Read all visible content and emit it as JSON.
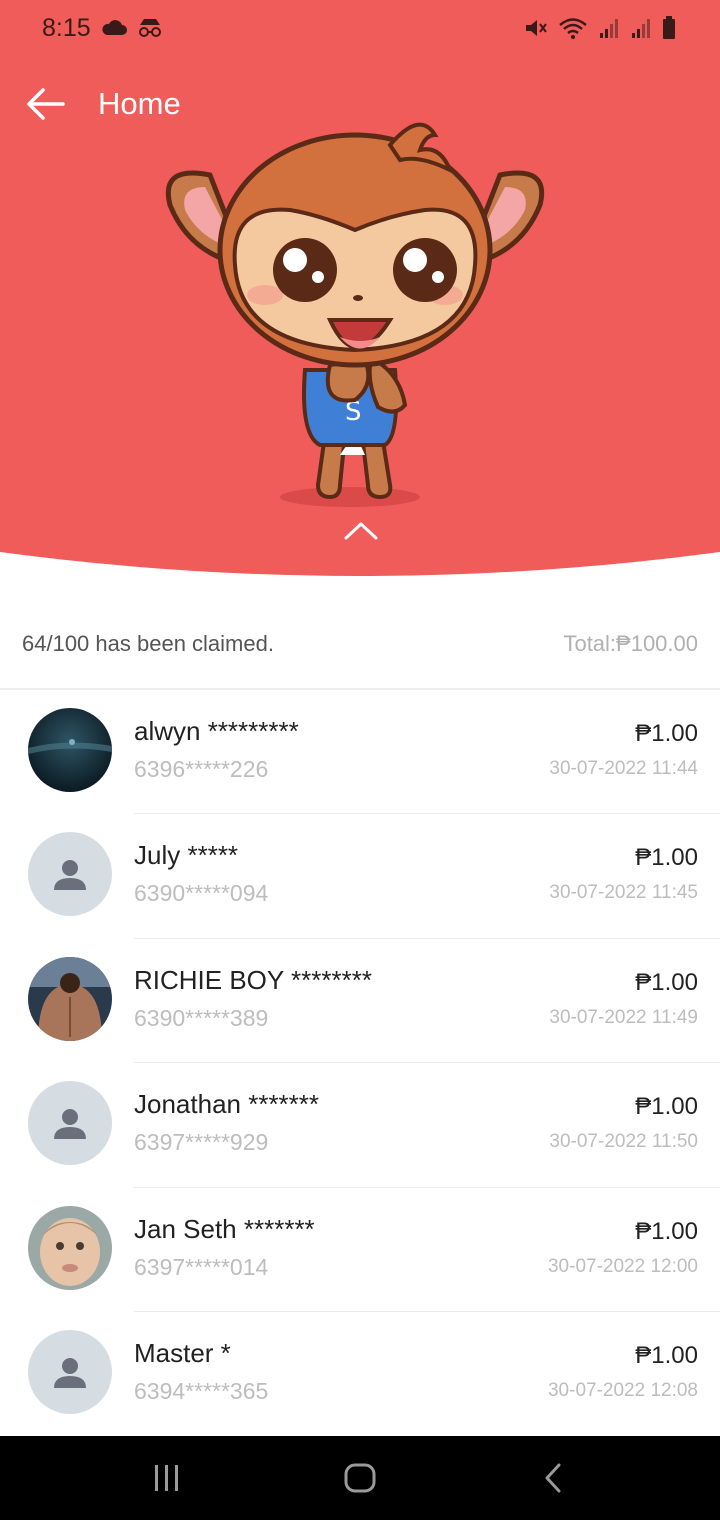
{
  "status_bar": {
    "time": "8:15",
    "icons_left": [
      "cloud-icon",
      "incognito-icon"
    ],
    "icons_right": [
      "mute-icon",
      "wifi-icon",
      "signal-icon",
      "signal-icon-2",
      "battery-icon"
    ]
  },
  "header": {
    "title": "Home",
    "back_icon": "arrow-left-icon",
    "expand_icon": "chevron-up-icon"
  },
  "summary": {
    "claimed": "64/100 has been claimed.",
    "total": "Total:₱100.00"
  },
  "claims": [
    {
      "name": "alwyn *********",
      "phone": "6396*****226",
      "amount": "₱1.00",
      "time": "30-07-2022 11:44",
      "avatar": "photo-dark-water"
    },
    {
      "name": "July *****",
      "phone": "6390*****094",
      "amount": "₱1.00",
      "time": "30-07-2022 11:45",
      "avatar": "default"
    },
    {
      "name": "RICHIE BOY ********",
      "phone": "6390*****389",
      "amount": "₱1.00",
      "time": "30-07-2022 11:49",
      "avatar": "photo-muscle-back"
    },
    {
      "name": "Jonathan *******",
      "phone": "6397*****929",
      "amount": "₱1.00",
      "time": "30-07-2022 11:50",
      "avatar": "default"
    },
    {
      "name": "Jan Seth *******",
      "phone": "6397*****014",
      "amount": "₱1.00",
      "time": "30-07-2022 12:00",
      "avatar": "photo-baby"
    },
    {
      "name": "Master *",
      "phone": "6394*****365",
      "amount": "₱1.00",
      "time": "30-07-2022 12:08",
      "avatar": "default"
    }
  ],
  "nav": [
    "recent-apps-icon",
    "home-icon",
    "back-icon"
  ],
  "colors": {
    "header_red": "#f05c5a",
    "text_primary": "#222222",
    "text_muted": "#bdbdbd"
  }
}
